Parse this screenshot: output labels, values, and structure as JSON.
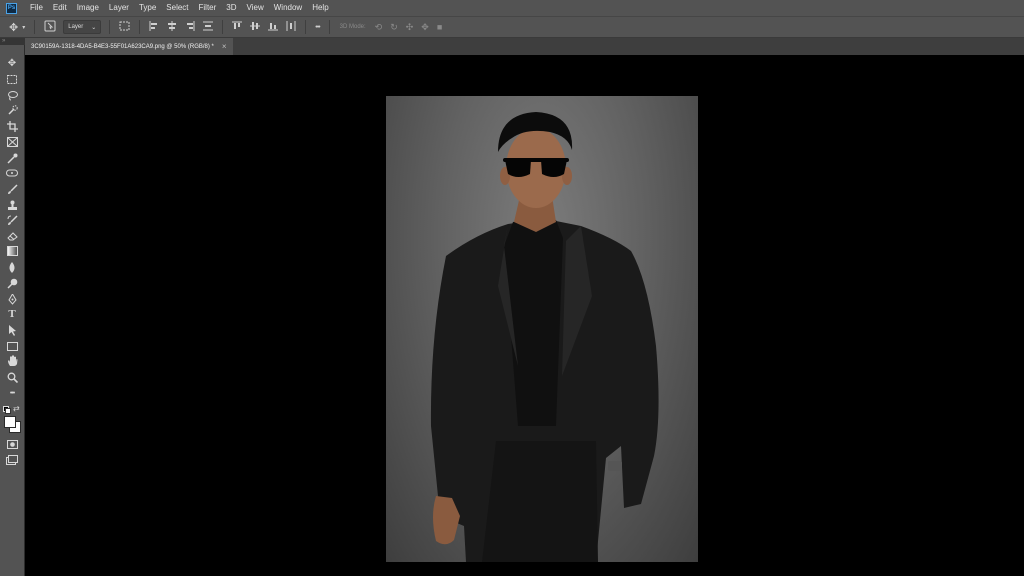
{
  "menubar": {
    "logo": "Ps",
    "items": [
      "File",
      "Edit",
      "Image",
      "Layer",
      "Type",
      "Select",
      "Filter",
      "3D",
      "View",
      "Window",
      "Help"
    ]
  },
  "options": {
    "auto_select": "Layer",
    "mode_3d": "3D Mode:",
    "more": "•••"
  },
  "document": {
    "tab_title": "3C90159A-1318-4DA5-B4E3-55F01A623CA9.png @ 50% (RGB/8) *",
    "close": "×"
  },
  "toolbar": {
    "collapse": "»",
    "text_tool": "T",
    "more": "•••"
  },
  "colors": {
    "background": "#535353",
    "canvas": "#000000",
    "photo_bg": "#636363"
  }
}
